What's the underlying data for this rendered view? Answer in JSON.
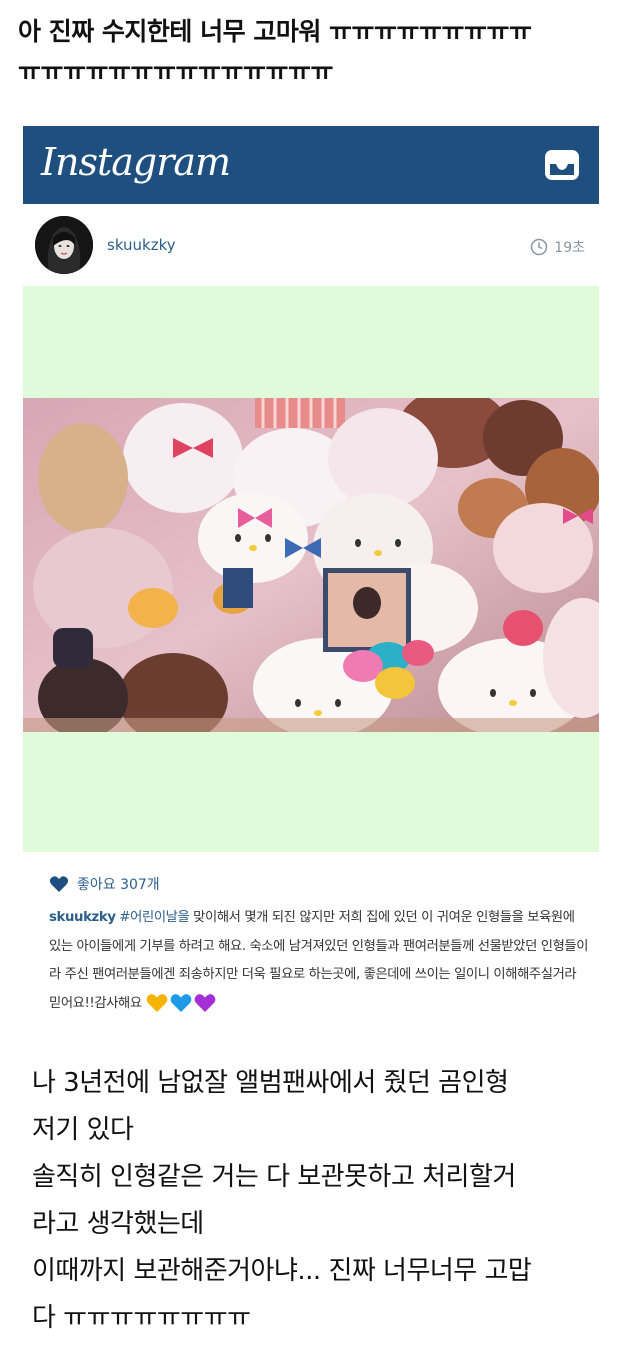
{
  "title": {
    "line1": "아 진짜 수지한테 너무 고마워 ㅠㅠㅠㅠㅠㅠㅠㅠㅠ",
    "line2": "ㅠㅠㅠㅠㅠㅠㅠㅠㅠㅠㅠㅠㅠㅠ"
  },
  "instagram": {
    "logo": "Instagram",
    "inbox_icon": "inbox-tray-icon",
    "header_color": "#1f4f7e"
  },
  "post": {
    "username": "skuukzky",
    "time": "19초",
    "likes": "좋아요 307개",
    "caption": {
      "username": "skuukzky",
      "hashtag": "#어린이날을",
      "text": " 맞이해서 몇개 되진 않지만 저희 집에 있던 이 귀여운 인형들을 보육원에 있는 아이들에게 기부를 하려고 해요. 숙소에 남겨져있던 인형들과 팬여러분들께 선물받았던 인형들이라 주신 팬여러분들에겐 죄송하지만 더욱 필요로 하는곳에, 좋은데에 쓰이는 일이니 이해해주실거라 믿어요!!감사해요 "
    },
    "emoji_colors": [
      "#f6b400",
      "#1e9be8",
      "#a52fd6"
    ]
  },
  "comment": {
    "lines": [
      "나 3년전에 남없잘 앨범팬싸에서 줬던 곰인형",
      "저기 있다",
      "솔직히 인형같은 거는 다 보관못하고 처리할거",
      "라고 생각했는데",
      "이때까지 보관해준거아냐... 진짜 너무너무 고맙",
      "다 ㅠㅠㅠㅠㅠㅠㅠㅠ"
    ]
  }
}
